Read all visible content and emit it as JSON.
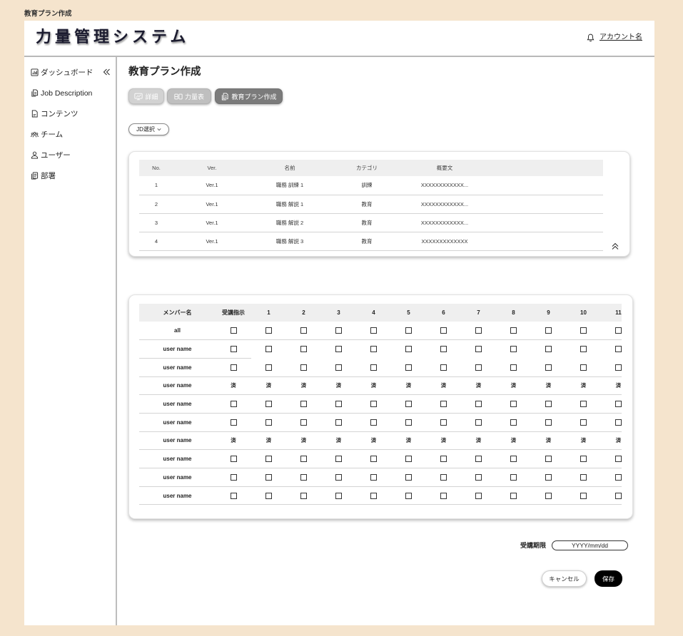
{
  "page_label": "教育プラン作成",
  "header": {
    "title": "力量管理システム",
    "account": "アカウント名",
    "notification_icon": "bell-icon"
  },
  "sidebar": {
    "collapse_icon": "double-chevron-left-icon",
    "items": [
      {
        "label": "ダッシュボード",
        "icon": "bar-chart-icon"
      },
      {
        "label": "Job Description",
        "icon": "copy-icon"
      },
      {
        "label": "コンテンツ",
        "icon": "document-icon"
      },
      {
        "label": "チーム",
        "icon": "team-icon"
      },
      {
        "label": "ユーザー",
        "icon": "user-icon"
      },
      {
        "label": "部署",
        "icon": "documents-icon"
      }
    ]
  },
  "main": {
    "title": "教育プラン作成",
    "tabs": [
      {
        "label": "詳細",
        "icon": "presentation-icon",
        "active": false
      },
      {
        "label": "力量表",
        "icon": "columns-icon",
        "active": false
      },
      {
        "label": "教育プラン作成",
        "icon": "copy-icon",
        "active": true
      }
    ],
    "jd_select": {
      "label": "JD選択",
      "icon": "chevron-down-icon"
    },
    "jd_table": {
      "collapse_icon": "double-chevron-up-icon",
      "columns": [
        "No.",
        "Ver.",
        "名前",
        "カテゴリ",
        "概要文"
      ],
      "rows": [
        [
          "1",
          "Ver.1",
          "職務 訓練 1",
          "訓練",
          "XXXXXXXXXXXX..."
        ],
        [
          "2",
          "Ver.1",
          "職務 解説 1",
          "教育",
          "XXXXXXXXXXXX..."
        ],
        [
          "3",
          "Ver.1",
          "職務 解説 2",
          "教育",
          "XXXXXXXXXXXX..."
        ],
        [
          "4",
          "Ver.1",
          "職務 解説 3",
          "教育",
          "XXXXXXXXXXXXX"
        ]
      ]
    },
    "plan_table": {
      "columns": [
        "メンバー名",
        "受講指示",
        "1",
        "2",
        "3",
        "4",
        "5",
        "6",
        "7",
        "8",
        "9",
        "10",
        "11"
      ],
      "rows": [
        {
          "name": "all",
          "cells": [
            false,
            false,
            false,
            false,
            false,
            false,
            false,
            false,
            false,
            false,
            false,
            false
          ]
        },
        {
          "name": "user name",
          "cells": [
            false,
            false,
            false,
            false,
            false,
            false,
            false,
            false,
            false,
            false,
            false,
            false
          ]
        },
        {
          "name": "user name",
          "cells": [
            false,
            false,
            false,
            false,
            false,
            false,
            false,
            false,
            false,
            false,
            false,
            false
          ]
        },
        {
          "name": "user name",
          "cells": [
            "済",
            "済",
            "済",
            "済",
            "済",
            "済",
            "済",
            "済",
            "済",
            "済",
            "済",
            "済"
          ]
        },
        {
          "name": "user name",
          "cells": [
            false,
            false,
            false,
            false,
            false,
            false,
            false,
            false,
            false,
            false,
            false,
            false
          ]
        },
        {
          "name": "user name",
          "cells": [
            false,
            false,
            false,
            false,
            false,
            false,
            false,
            false,
            false,
            false,
            false,
            false
          ]
        },
        {
          "name": "user name",
          "cells": [
            "済",
            "済",
            "済",
            "済",
            "済",
            "済",
            "済",
            "済",
            "済",
            "済",
            "済",
            "済"
          ]
        },
        {
          "name": "user name",
          "cells": [
            false,
            false,
            false,
            false,
            false,
            false,
            false,
            false,
            false,
            false,
            false,
            false
          ]
        },
        {
          "name": "user name",
          "cells": [
            false,
            false,
            false,
            false,
            false,
            false,
            false,
            false,
            false,
            false,
            false,
            false
          ]
        },
        {
          "name": "user name",
          "cells": [
            false,
            false,
            false,
            false,
            false,
            false,
            false,
            false,
            false,
            false,
            false,
            false
          ]
        }
      ]
    },
    "deadline": {
      "label": "受講期限",
      "placeholder": "YYYY/mm/dd"
    },
    "actions": {
      "cancel": "キャンセル",
      "save": "保存"
    }
  },
  "colors": {
    "background": "#f5e4cd",
    "surface": "#ffffff",
    "tab_active": "#7b7b7b",
    "save_button": "#000000",
    "table_header": "#efefef"
  }
}
